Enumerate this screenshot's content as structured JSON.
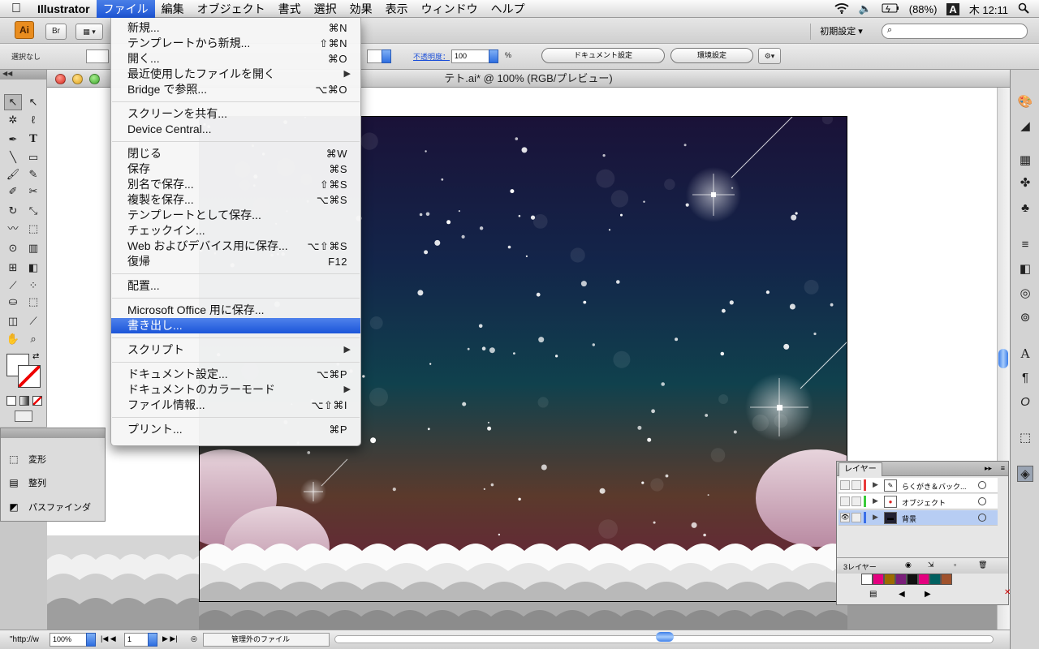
{
  "menubar": {
    "app_name": "Illustrator",
    "items": [
      "ファイル",
      "編集",
      "オブジェクト",
      "書式",
      "選択",
      "効果",
      "表示",
      "ウィンドウ",
      "ヘルプ"
    ],
    "battery": "(88%)",
    "input_mode": "A",
    "clock": "木 12:11"
  },
  "control": {
    "ai_logo": "Ai",
    "br_label": "Br",
    "workspace": "初期設定 ▾",
    "selection_status": "選択なし",
    "opacity_label": "不透明度：",
    "opacity_value": "100",
    "percent": "%",
    "doc_setup_button": "ドキュメント設定",
    "prefs_button": "環境設定"
  },
  "document": {
    "title": "テト.ai* @ 100% (RGB/プレビュー)"
  },
  "status": {
    "url_fragment": "\"http://w",
    "zoom": "100%",
    "artboard": "1",
    "info": "管理外のファイル"
  },
  "side_panel": {
    "items": [
      {
        "label": "変形",
        "icon": "transform-icon"
      },
      {
        "label": "整列",
        "icon": "align-icon"
      },
      {
        "label": "パスファインダ",
        "icon": "pathfinder-icon"
      }
    ]
  },
  "layers_panel": {
    "tab": "レイヤー",
    "rows": [
      {
        "name": "らくがき＆バック...",
        "color": "#e83a3a",
        "visible": false,
        "selected": false
      },
      {
        "name": "オブジェクト",
        "color": "#3acb3a",
        "visible": false,
        "selected": false
      },
      {
        "name": "背景",
        "color": "#3a6fe8",
        "visible": true,
        "selected": true
      }
    ],
    "count": "3レイヤー"
  },
  "swatches": [
    "#ffffff",
    "#e4007f",
    "#9c6b00",
    "#7a1f7a",
    "#111111",
    "#e4007f",
    "#006060",
    "#a0522d"
  ],
  "file_menu": {
    "items": [
      {
        "label": "新規...",
        "shortcut": "⌘N"
      },
      {
        "label": "テンプレートから新規...",
        "shortcut": "⇧⌘N"
      },
      {
        "label": "開く...",
        "shortcut": "⌘O"
      },
      {
        "label": "最近使用したファイルを開く",
        "submenu": true
      },
      {
        "label": "Bridge で参照...",
        "shortcut": "⌥⌘O"
      },
      {
        "sep": true
      },
      {
        "label": "スクリーンを共有..."
      },
      {
        "label": "Device Central..."
      },
      {
        "sep": true
      },
      {
        "label": "閉じる",
        "shortcut": "⌘W"
      },
      {
        "label": "保存",
        "shortcut": "⌘S"
      },
      {
        "label": "別名で保存...",
        "shortcut": "⇧⌘S"
      },
      {
        "label": "複製を保存...",
        "shortcut": "⌥⌘S"
      },
      {
        "label": "テンプレートとして保存..."
      },
      {
        "label": "チェックイン..."
      },
      {
        "label": "Web およびデバイス用に保存...",
        "shortcut": "⌥⇧⌘S"
      },
      {
        "label": "復帰",
        "shortcut": "F12"
      },
      {
        "sep": true
      },
      {
        "label": "配置..."
      },
      {
        "sep": true
      },
      {
        "label": "Microsoft Office 用に保存..."
      },
      {
        "label": "書き出し...",
        "highlighted": true
      },
      {
        "sep": true
      },
      {
        "label": "スクリプト",
        "submenu": true
      },
      {
        "sep": true
      },
      {
        "label": "ドキュメント設定...",
        "shortcut": "⌥⌘P"
      },
      {
        "label": "ドキュメントのカラーモード",
        "submenu": true
      },
      {
        "label": "ファイル情報...",
        "shortcut": "⌥⇧⌘I"
      },
      {
        "sep": true
      },
      {
        "label": "プリント...",
        "shortcut": "⌘P"
      }
    ]
  }
}
